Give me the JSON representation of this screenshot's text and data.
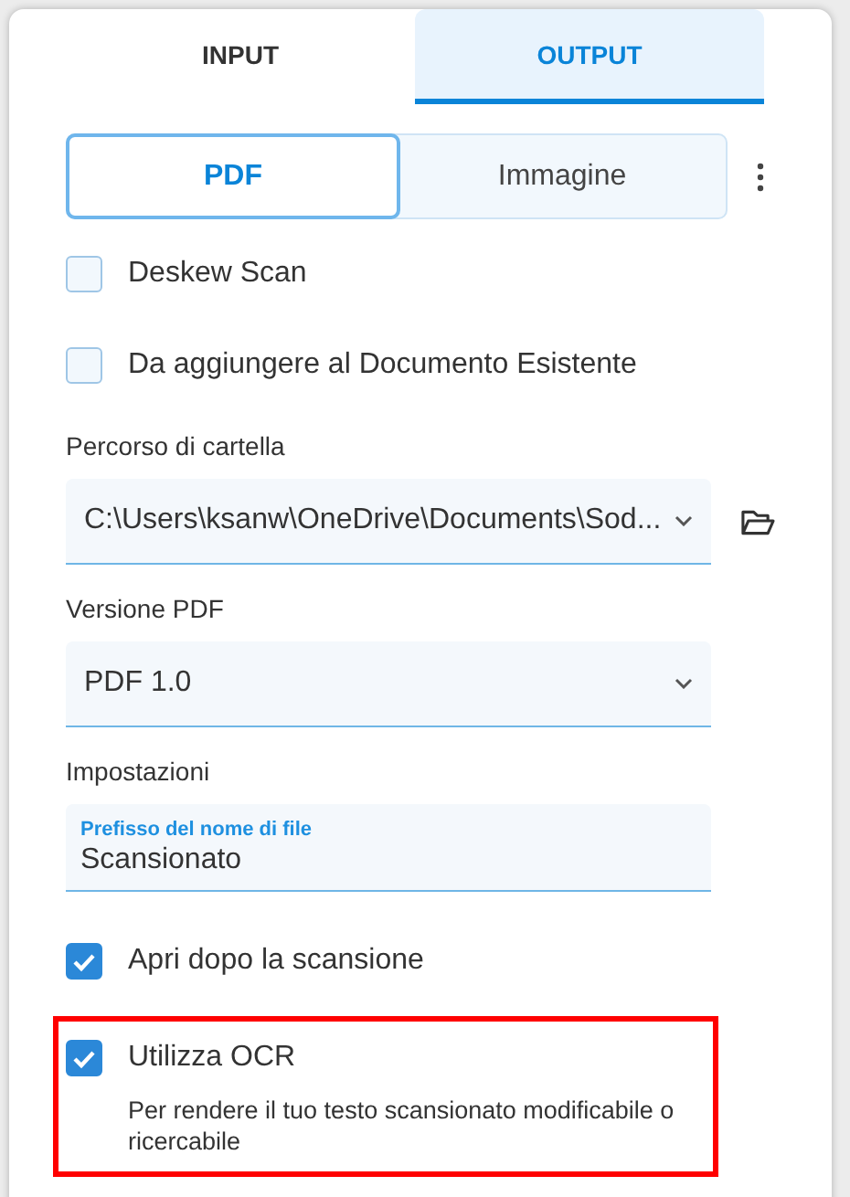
{
  "tabs": [
    {
      "label": "INPUT",
      "selected": false
    },
    {
      "label": "OUTPUT",
      "selected": true
    }
  ],
  "format": [
    {
      "label": "PDF",
      "selected": true
    },
    {
      "label": "Immagine",
      "selected": false
    }
  ],
  "options_top": [
    {
      "label": "Deskew Scan",
      "checked": false
    },
    {
      "label": "Da aggiungere al Documento Esistente",
      "checked": false
    }
  ],
  "folder": {
    "label": "Percorso di cartella",
    "value": "C:\\Users\\ksanw\\OneDrive\\Documents\\Sod..."
  },
  "pdf_version": {
    "label": "Versione PDF",
    "value": "PDF 1.0"
  },
  "settings": {
    "label": "Impostazioni",
    "field_label": "Prefisso del nome di file",
    "value": "Scansionato"
  },
  "options_bottom": [
    {
      "label": "Apri dopo la scansione",
      "checked": true,
      "highlighted": false
    },
    {
      "label": "Utilizza OCR",
      "checked": true,
      "highlighted": true,
      "description": "Per rendere il tuo testo scansionato modificabile o ricercabile"
    }
  ]
}
